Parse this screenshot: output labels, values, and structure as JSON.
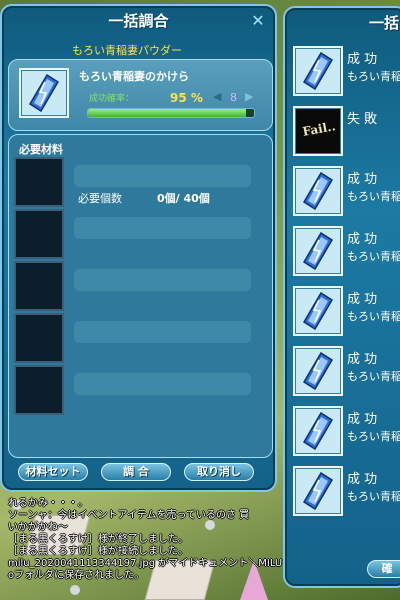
{
  "craft_window": {
    "title": "一括調合",
    "close_icon": "close-icon",
    "result": {
      "item_name": "もろい青稲妻のかけら",
      "rate_label": "成功確率：",
      "rate_value": "95 %",
      "count": "8",
      "progress_fraction": 0.95
    },
    "materials": {
      "header": "必要材料",
      "rows": [
        {
          "name": "もろい青稲妻パウダー",
          "required_label": "必要個数",
          "required_value": "0個/ 40個"
        },
        {
          "name": "",
          "required_label": "",
          "required_value": ""
        },
        {
          "name": "",
          "required_label": "",
          "required_value": ""
        },
        {
          "name": "",
          "required_label": "",
          "required_value": ""
        },
        {
          "name": "",
          "required_label": "",
          "required_value": ""
        }
      ]
    },
    "buttons": {
      "material_set": "材料セット",
      "craft": "調 合",
      "cancel": "取り消し"
    }
  },
  "results_window": {
    "title": "一括",
    "fail_icon_text": "Fail..",
    "items": [
      {
        "status": "成 功",
        "name": "もろい青稲",
        "icon": "blue-lightning-shard-icon"
      },
      {
        "status": "失 敗",
        "name": "",
        "icon": "fail-icon"
      },
      {
        "status": "成 功",
        "name": "もろい青稲",
        "icon": "blue-lightning-shard-icon"
      },
      {
        "status": "成 功",
        "name": "もろい青稲",
        "icon": "blue-lightning-shard-icon"
      },
      {
        "status": "成 功",
        "name": "もろい青稲",
        "icon": "blue-lightning-shard-icon"
      },
      {
        "status": "成 功",
        "name": "もろい青稲",
        "icon": "blue-lightning-shard-icon"
      },
      {
        "status": "成 功",
        "name": "もろい青稲",
        "icon": "blue-lightning-shard-icon"
      },
      {
        "status": "成 功",
        "name": "もろい青稲",
        "icon": "blue-lightning-shard-icon"
      }
    ],
    "confirm_label": "確"
  },
  "chat": [
    "れるかみ・・・。",
    "ソーンャ：今はイベントアイテムを売っているのさ 買",
    "いかがかね～",
    "［まる黒くろすけ］様が終了しました。",
    "［まる黒くろすけ］様が接続しました。",
    "milu_2020041113344197.jpg がマイドキュメント＼MILU",
    "oフォルダに保存されました。"
  ],
  "colors": {
    "window_blue": "#1c7aa3",
    "rate_green": "#7fe35a",
    "highlight_yellow": "#ffe14a"
  }
}
